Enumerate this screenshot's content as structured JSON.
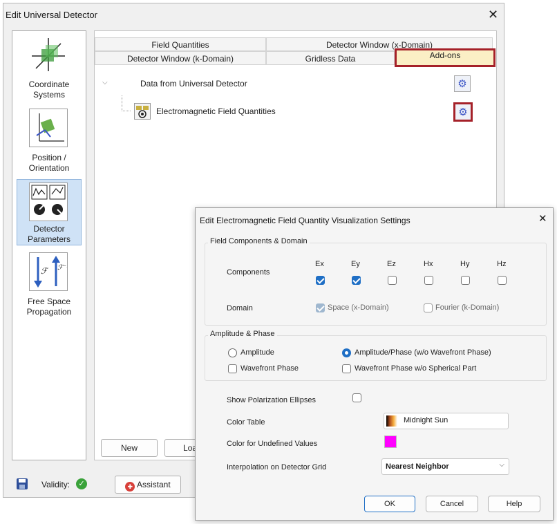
{
  "window": {
    "title": "Edit Universal Detector"
  },
  "sidebar": {
    "items": [
      {
        "label_1": "Coordinate",
        "label_2": "Systems"
      },
      {
        "label_1": "Position /",
        "label_2": "Orientation"
      },
      {
        "label_1": "Detector",
        "label_2": "Parameters"
      },
      {
        "label_1": "Free Space",
        "label_2": "Propagation"
      }
    ]
  },
  "tabs": {
    "row1": [
      "Field Quantities",
      "Detector Window (x-Domain)"
    ],
    "row2": [
      "Detector Window (k-Domain)",
      "Gridless Data",
      "Add-ons"
    ]
  },
  "tree": {
    "root": "Data from Universal Detector",
    "child": "Electromagnetic Field Quantities"
  },
  "content_buttons": {
    "new": "New",
    "load": "Loa"
  },
  "footer": {
    "validity": "Validity:",
    "assistant": "Assistant"
  },
  "dialog": {
    "title": "Edit Electromagnetic Field Quantity Visualization Settings",
    "field_components": {
      "group_title": "Field Components & Domain",
      "components_label": "Components",
      "columns": [
        "Ex",
        "Ey",
        "Ez",
        "Hx",
        "Hy",
        "Hz"
      ],
      "checked": [
        true,
        true,
        false,
        false,
        false,
        false
      ],
      "domain_label": "Domain",
      "space_label": "Space (x-Domain)",
      "fourier_label": "Fourier (k-Domain)"
    },
    "amp_phase": {
      "group_title": "Amplitude & Phase",
      "amplitude": "Amplitude",
      "amplitude_phase": "Amplitude/Phase (w/o Wavefront Phase)",
      "wavefront_phase": "Wavefront Phase",
      "wavefront_wo_spherical": "Wavefront Phase w/o Spherical Part"
    },
    "show_polarization": "Show Polarization Ellipses",
    "color_table_label": "Color Table",
    "color_table_value": "Midnight Sun",
    "undefined_color_label": "Color for Undefined Values",
    "undefined_color": "#ff00ff",
    "interpolation_label": "Interpolation on Detector Grid",
    "interpolation_value": "Nearest Neighbor",
    "buttons": {
      "ok": "OK",
      "cancel": "Cancel",
      "help": "Help"
    }
  },
  "colors": {
    "accent": "#1f6fc5",
    "highlight_border": "#a52129",
    "tab_active_bg": "#fbefc5",
    "gear": "#3b55c6"
  }
}
